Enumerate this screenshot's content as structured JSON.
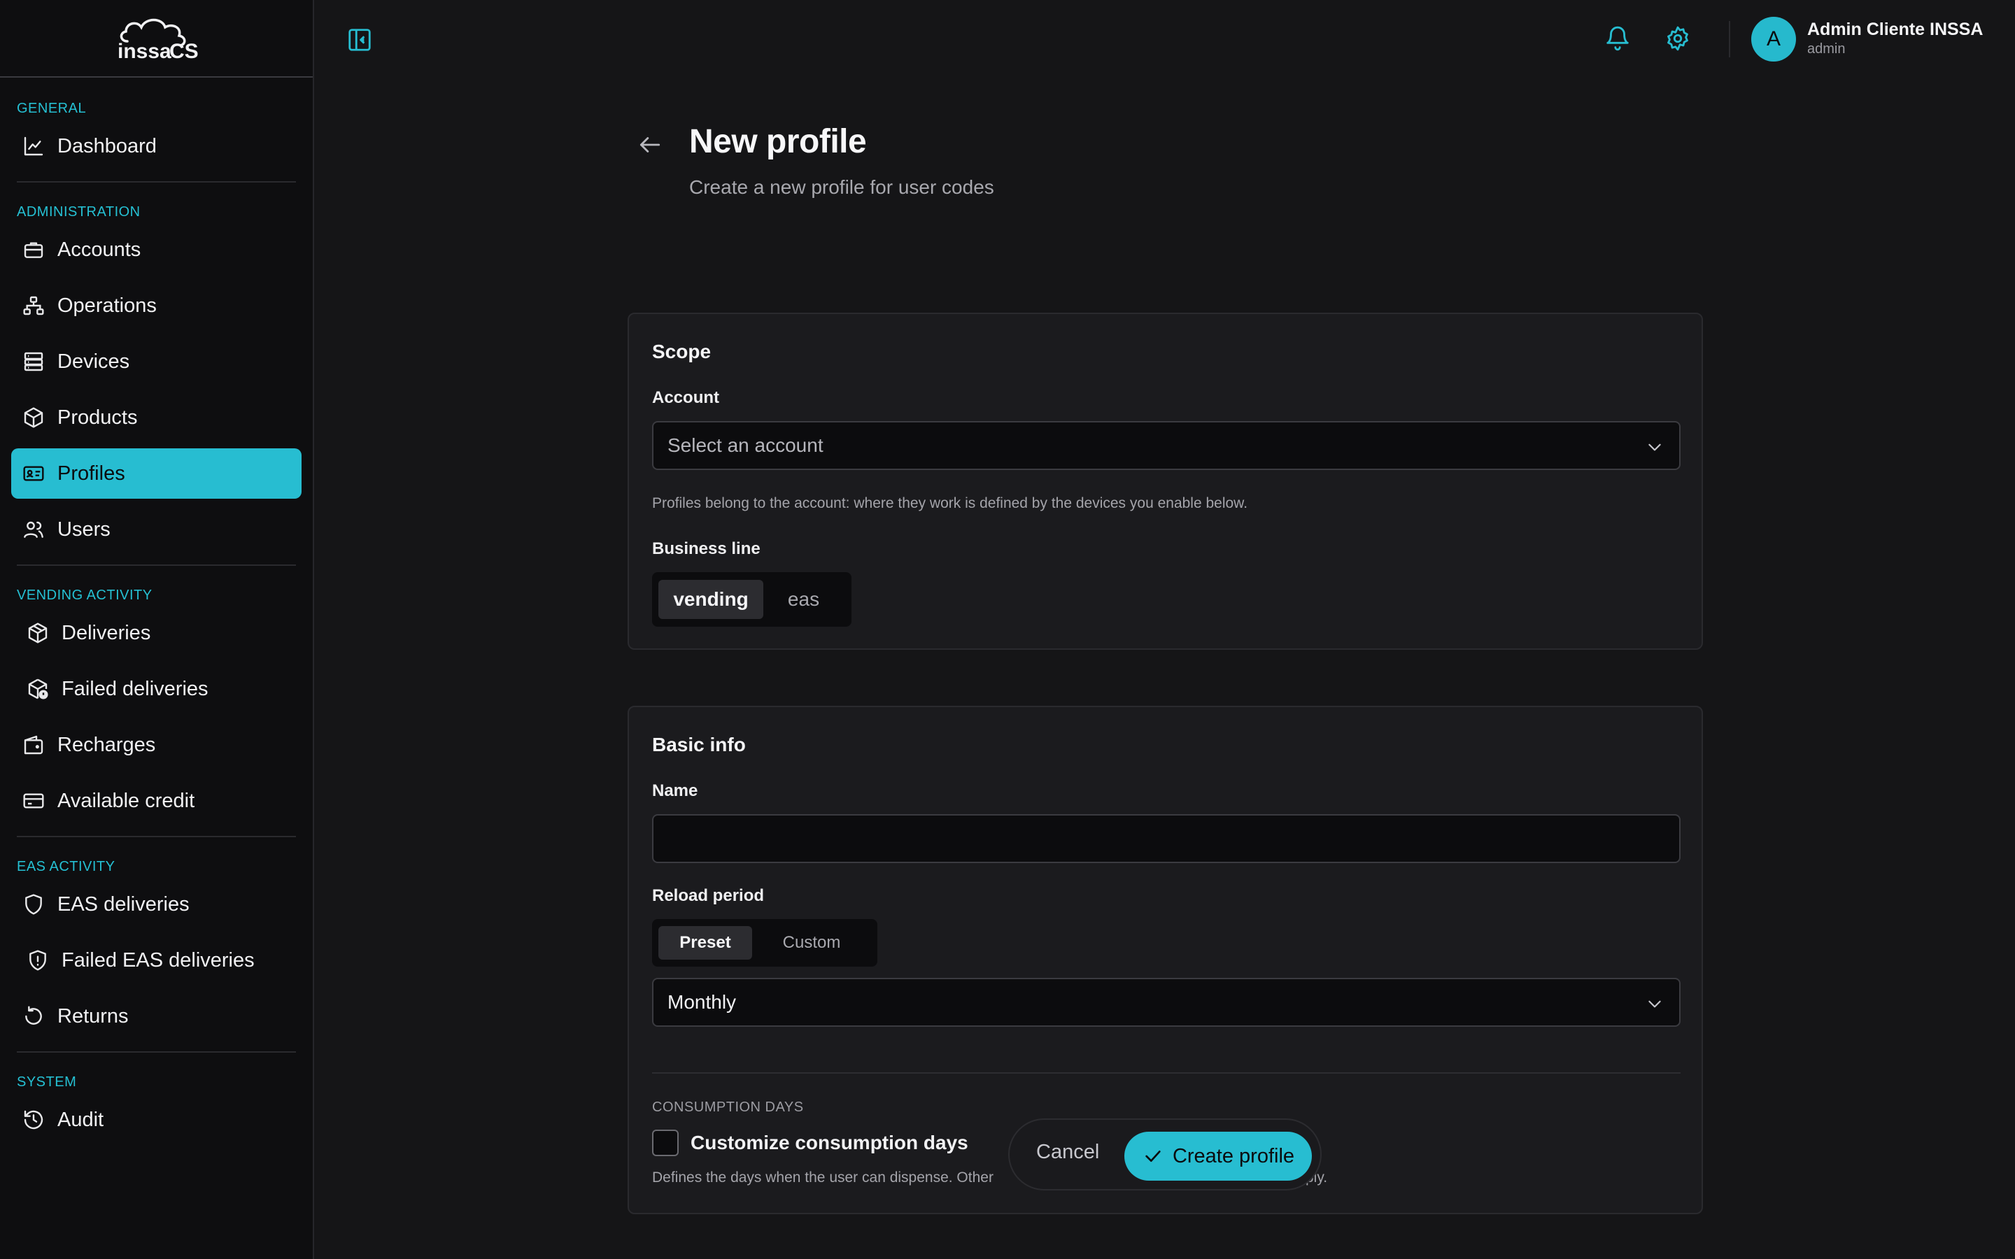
{
  "brand": {
    "logo_text": "inssa CS",
    "accent": "#27bdd1"
  },
  "sidebar": {
    "sections": [
      {
        "title": "GENERAL",
        "items": [
          {
            "label": "Dashboard",
            "icon": "chart-line-icon"
          }
        ]
      },
      {
        "title": "ADMINISTRATION",
        "items": [
          {
            "label": "Accounts",
            "icon": "briefcase-icon"
          },
          {
            "label": "Operations",
            "icon": "network-icon"
          },
          {
            "label": "Devices",
            "icon": "server-icon"
          },
          {
            "label": "Products",
            "icon": "box-icon"
          },
          {
            "label": "Profiles",
            "icon": "id-card-icon",
            "active": true
          },
          {
            "label": "Users",
            "icon": "users-icon"
          }
        ]
      },
      {
        "title": "VENDING ACTIVITY",
        "items": [
          {
            "label": "Deliveries",
            "icon": "package-icon"
          },
          {
            "label": "Failed deliveries",
            "icon": "package-alert-icon"
          },
          {
            "label": "Recharges",
            "icon": "wallet-icon"
          },
          {
            "label": "Available credit",
            "icon": "credit-card-icon"
          }
        ]
      },
      {
        "title": "EAS ACTIVITY",
        "items": [
          {
            "label": "EAS deliveries",
            "icon": "shield-icon"
          },
          {
            "label": "Failed EAS deliveries",
            "icon": "shield-alert-icon"
          },
          {
            "label": "Returns",
            "icon": "rotate-icon"
          }
        ]
      },
      {
        "title": "SYSTEM",
        "items": [
          {
            "label": "Audit",
            "icon": "history-icon"
          }
        ]
      }
    ]
  },
  "topbar": {
    "user": {
      "initial": "A",
      "name": "Admin Cliente INSSA",
      "role": "admin"
    }
  },
  "page": {
    "title": "New profile",
    "subtitle": "Create a new profile for user codes"
  },
  "scope": {
    "title": "Scope",
    "account_label": "Account",
    "account_placeholder": "Select an account",
    "account_help": "Profiles belong to the account: where they work is defined by the devices you enable below.",
    "business_line_label": "Business line",
    "business_lines": [
      "vending",
      "eas"
    ],
    "business_line_selected": "vending"
  },
  "basic": {
    "title": "Basic info",
    "name_label": "Name",
    "name_value": "",
    "reload_label": "Reload period",
    "reload_modes": [
      "Preset",
      "Custom"
    ],
    "reload_mode_selected": "Preset",
    "reload_value": "Monthly",
    "consumption_caps": "CONSUMPTION DAYS",
    "customize_label": "Customize consumption days",
    "customize_checked": false,
    "consumption_help_left": "Defines the days when the user can dispense. Other",
    "consumption_help_right": "ply."
  },
  "actions": {
    "cancel": "Cancel",
    "create": "Create profile"
  }
}
